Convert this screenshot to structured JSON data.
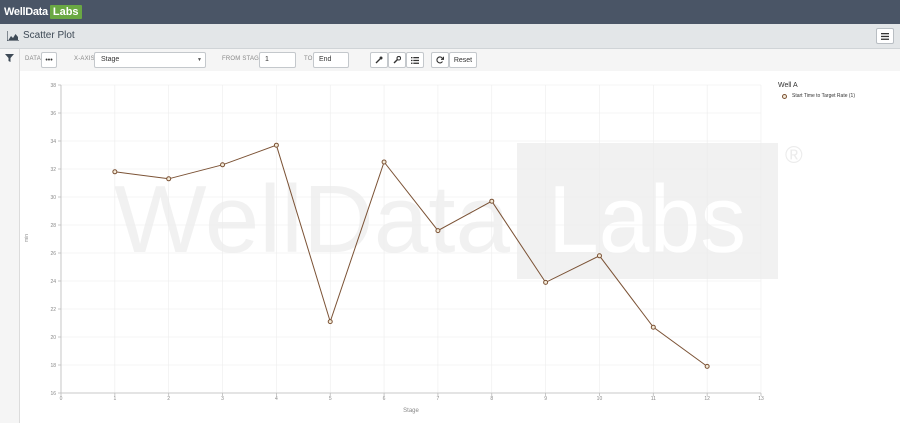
{
  "app": {
    "logo_part1": "WellData",
    "logo_part2": "Labs",
    "brand_color": "#6aa843"
  },
  "header": {
    "title": "Scatter Plot",
    "icon": "area-chart-icon",
    "menu_icon": "hamburger-menu-icon"
  },
  "toolbar": {
    "data_label": "DATA",
    "data_button": "•••",
    "xaxis_label": "X-AXIS",
    "xaxis_value": "Stage",
    "from_label": "FROM STAGE",
    "from_value": "1",
    "to_label": "TO",
    "to_value": "End",
    "tool_icons": [
      "eyedropper-icon",
      "wrench-icon",
      "list-icon",
      "refresh-icon"
    ],
    "reset_label": "Reset"
  },
  "watermark": {
    "text1": "WellData",
    "text2": "Labs",
    "reg": "®"
  },
  "legend": {
    "title": "Well A",
    "items": [
      "Start Time to Target Rate (1)"
    ]
  },
  "chart_data": {
    "type": "line",
    "xlabel": "Stage",
    "ylabel": "min",
    "xlim": [
      0,
      13
    ],
    "ylim": [
      16,
      38
    ],
    "xticks": [
      0,
      1,
      2,
      3,
      4,
      5,
      6,
      7,
      8,
      9,
      10,
      11,
      12,
      13
    ],
    "yticks": [
      16,
      18,
      20,
      22,
      24,
      26,
      28,
      30,
      32,
      34,
      36,
      38
    ],
    "grid": true,
    "legend_position": "top-right",
    "series": [
      {
        "name": "Start Time to Target Rate (1)",
        "color": "#7b5235",
        "x": [
          1,
          2,
          3,
          4,
          5,
          6,
          7,
          8,
          9,
          10,
          11,
          12
        ],
        "y": [
          31.8,
          31.3,
          32.3,
          33.7,
          21.1,
          32.5,
          27.6,
          29.7,
          23.9,
          25.8,
          20.7,
          17.9
        ]
      }
    ]
  }
}
